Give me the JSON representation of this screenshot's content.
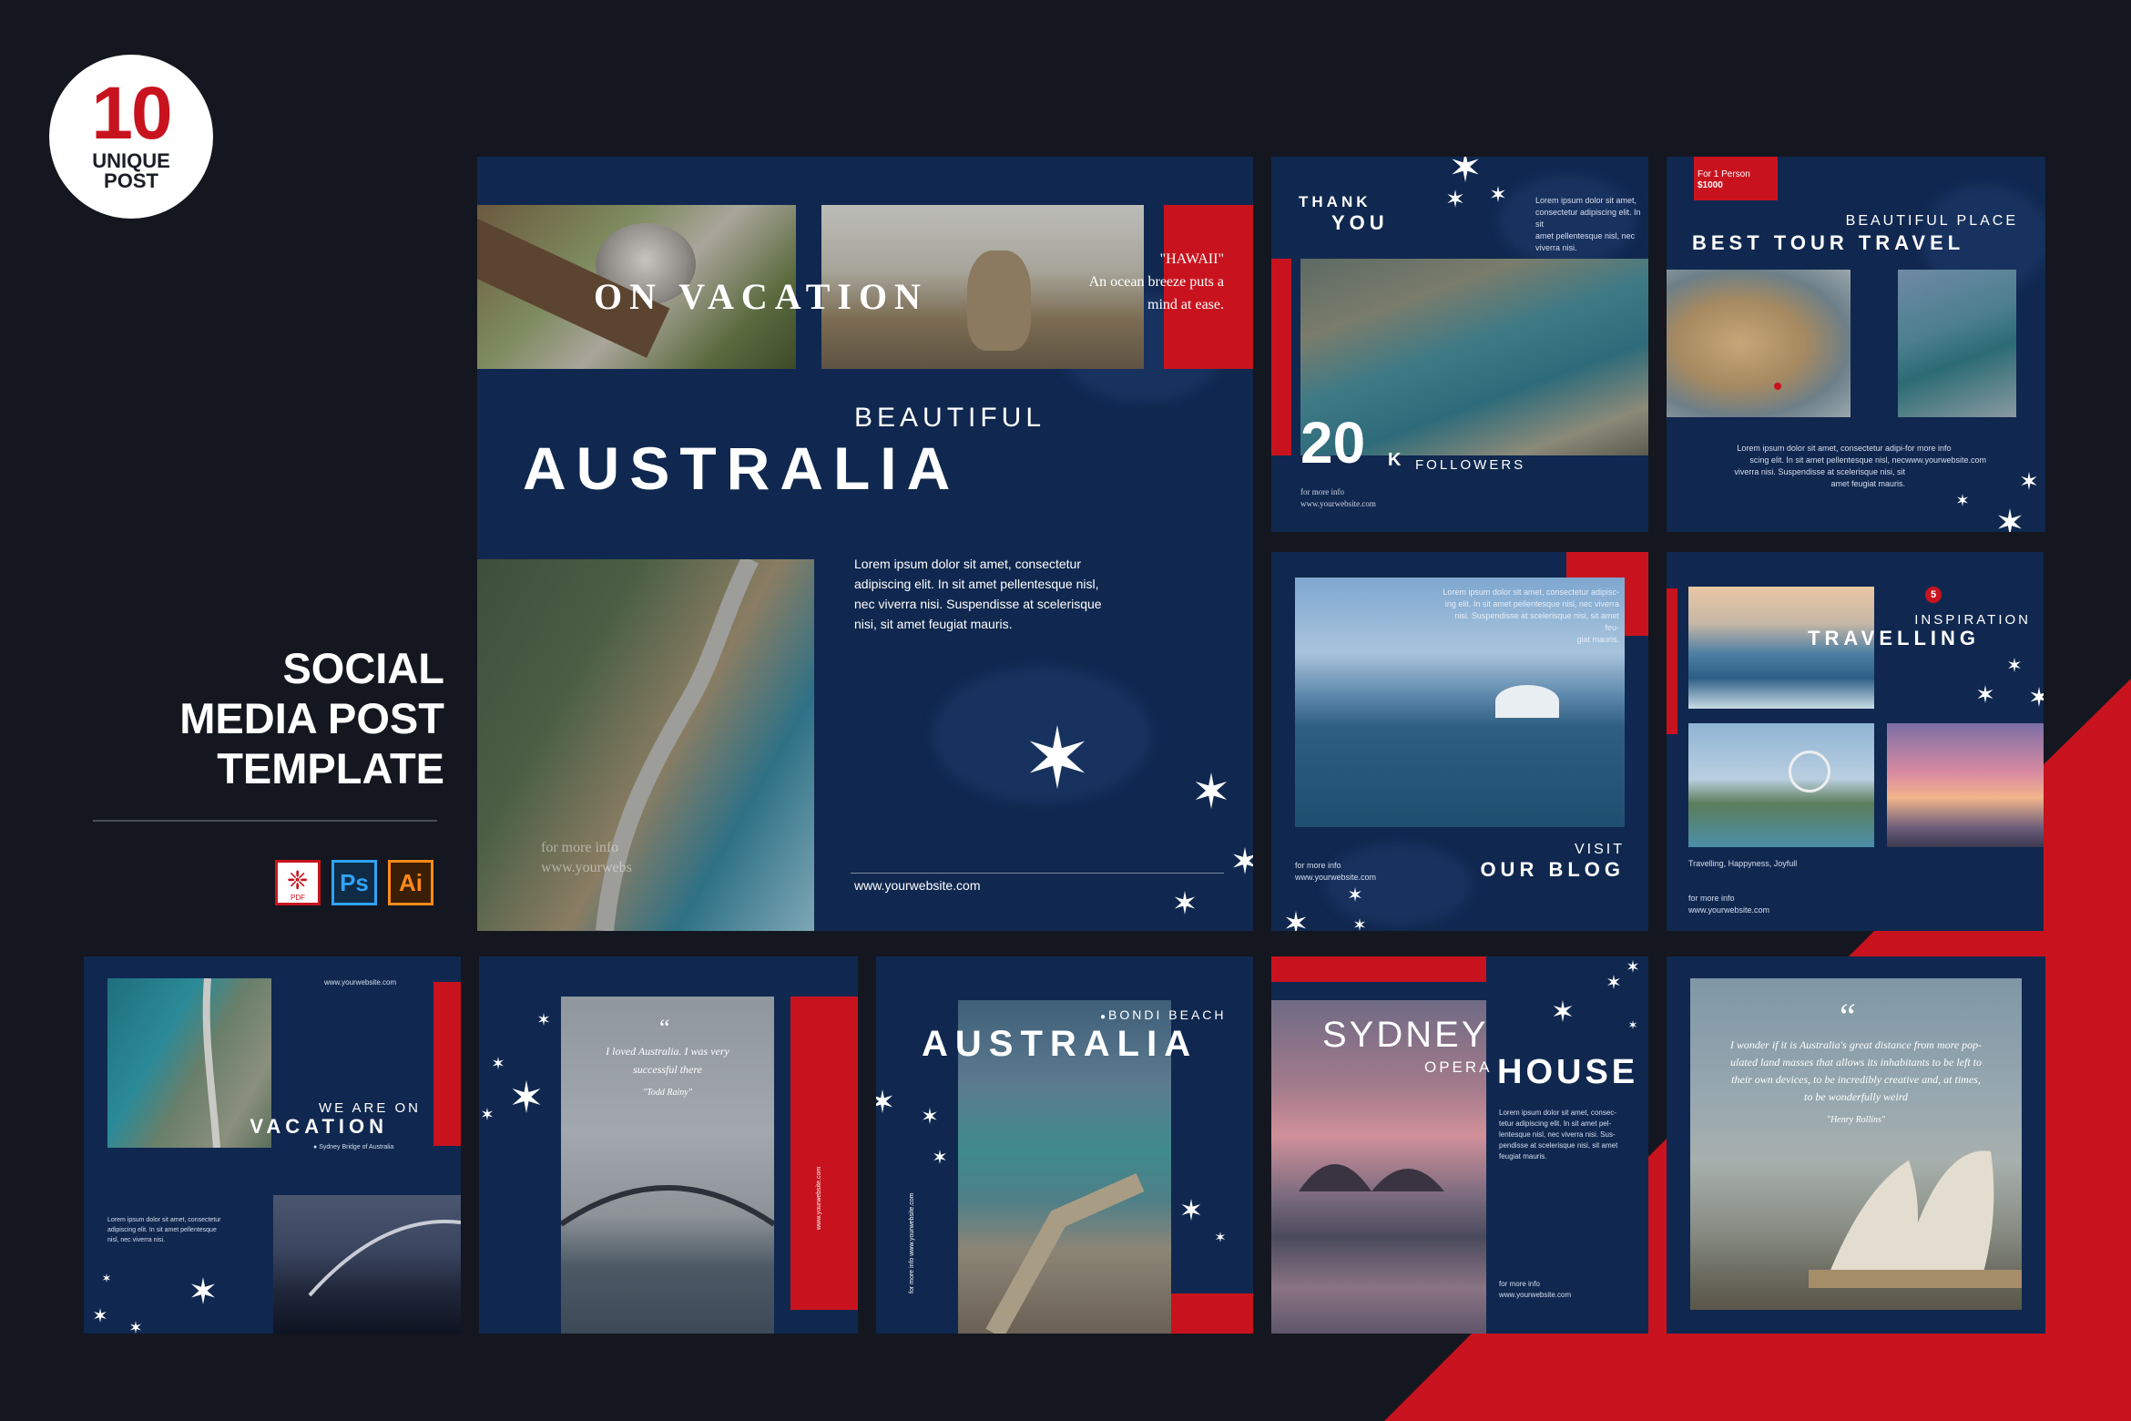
{
  "badge": {
    "number": "10",
    "line1": "UNIQUE",
    "line2": "POST"
  },
  "side": {
    "title1": "SOCIAL",
    "title2": "MEDIA POST",
    "title3": "TEMPLATE",
    "icons": [
      {
        "name": "pdf-icon",
        "label": "PDF"
      },
      {
        "name": "photoshop-icon",
        "label": "Ps"
      },
      {
        "name": "illustrator-icon",
        "label": "Ai"
      }
    ]
  },
  "colors": {
    "bg": "#14171f",
    "navy": "#10284f",
    "red": "#c8131e"
  },
  "main": {
    "vacation": "ON VACATION",
    "quote_title": "\"HAWAII\"",
    "quote_l1": "An ocean breeze puts a",
    "quote_l2": "mind at ease.",
    "beautiful": "BEAUTIFUL",
    "australia": "AUSTRALIA",
    "lorem_l1": "Lorem ipsum dolor sit amet, consectetur",
    "lorem_l2": "adipiscing elit. In sit amet pellentesque nisl,",
    "lorem_l3": "nec viverra nisi. Suspendisse at scelerisque",
    "lorem_l4": "nisi, sit amet feugiat mauris.",
    "info_l1": "for more info",
    "info_l2": "www.yourwebs",
    "website": "www.yourwebsite.com"
  },
  "thank": {
    "l1": "THANK",
    "l2": "YOU",
    "count": "20",
    "k": "K",
    "followers": "FOLLOWERS",
    "lorem_l1": "Lorem ipsum dolor sit amet,",
    "lorem_l2": "consectetur adipiscing elit. In sit",
    "lorem_l3": "amet pellentesque nisl, nec",
    "lorem_l4": "viverra nisi.",
    "info_l1": "for more info",
    "info_l2": "www.yourwebsite.com"
  },
  "tour": {
    "price_l1": "For 1 Person",
    "price_l2": "$1000",
    "beautiful": "BEAUTIFUL PLACE",
    "title": "BEST TOUR TRAVEL",
    "lorem_l1": "Lorem ipsum dolor sit amet, consectetur adipi-",
    "lorem_l2": "scing elit. In sit amet pellentesque nisl, nec",
    "lorem_l3": "viverra nisi. Suspendisse at scelerisque nisi, sit",
    "lorem_l4": "amet feugiat mauris.",
    "info_l1": "for more info",
    "info_l2": "www.yourwebsite.com"
  },
  "blog": {
    "lorem_l1": "Lorem ipsum dolor sit amet, consectetur adipisc-",
    "lorem_l2": "ing elit. In sit amet pellentesque nisl, nec viverra",
    "lorem_l3": "nisi. Suspendisse at scelerisque nisi, sit amet feu-",
    "lorem_l4": "giat mauris.",
    "info_l1": "for more info",
    "info_l2": "www.yourwebsite.com",
    "visit": "VISIT",
    "title": "OUR BLOG"
  },
  "travel": {
    "number": "5",
    "inspiration": "INSPIRATION",
    "title": "TRAVELLING",
    "tags": "Travelling, Happyness, Joyfull",
    "info_l1": "for more info",
    "info_l2": "www.yourwebsite.com"
  },
  "weare": {
    "website": "www.yourwebsite.com",
    "l1": "WE ARE ON",
    "l2": "VACATION",
    "location": "Sydney Bridge of Australia",
    "lorem_l1": "Lorem ipsum dolor sit amet, consectetur",
    "lorem_l2": "adipiscing elit. In sit amet pellentesque",
    "lorem_l3": "nisl, nec viverra nisi."
  },
  "loved": {
    "l1": "I loved Australia. I was very",
    "l2": "successful there",
    "author": "\"Todd Rainy\"",
    "side": "www.yourwebsite.com"
  },
  "bondi": {
    "label": "BONDI BEACH",
    "title": "AUSTRALIA",
    "side": "for more info www.yourwebsite.com"
  },
  "sydney": {
    "sydney": "SYDNEY",
    "opera": "OPERA",
    "house": "HOUSE",
    "lorem_l1": "Lorem ipsum dolor sit amet, consec-",
    "lorem_l2": "tetur adipiscing elit. In sit amet pel-",
    "lorem_l3": "lentesque nisl, nec viverra nisi. Sus-",
    "lorem_l4": "pendisse at scelerisque nisi, sit amet",
    "lorem_l5": "feugiat mauris.",
    "info_l1": "for more info",
    "info_l2": "www.yourwebsite.com"
  },
  "wonder": {
    "l1": "I wonder if it is Australia's great distance from more pop-",
    "l2": "ulated land masses that allows its inhabitants to be left to",
    "l3": "their own devices, to be incredibly creative and, at times,",
    "l4": "to be wonderfully weird",
    "author": "\"Henry Rollins\""
  }
}
